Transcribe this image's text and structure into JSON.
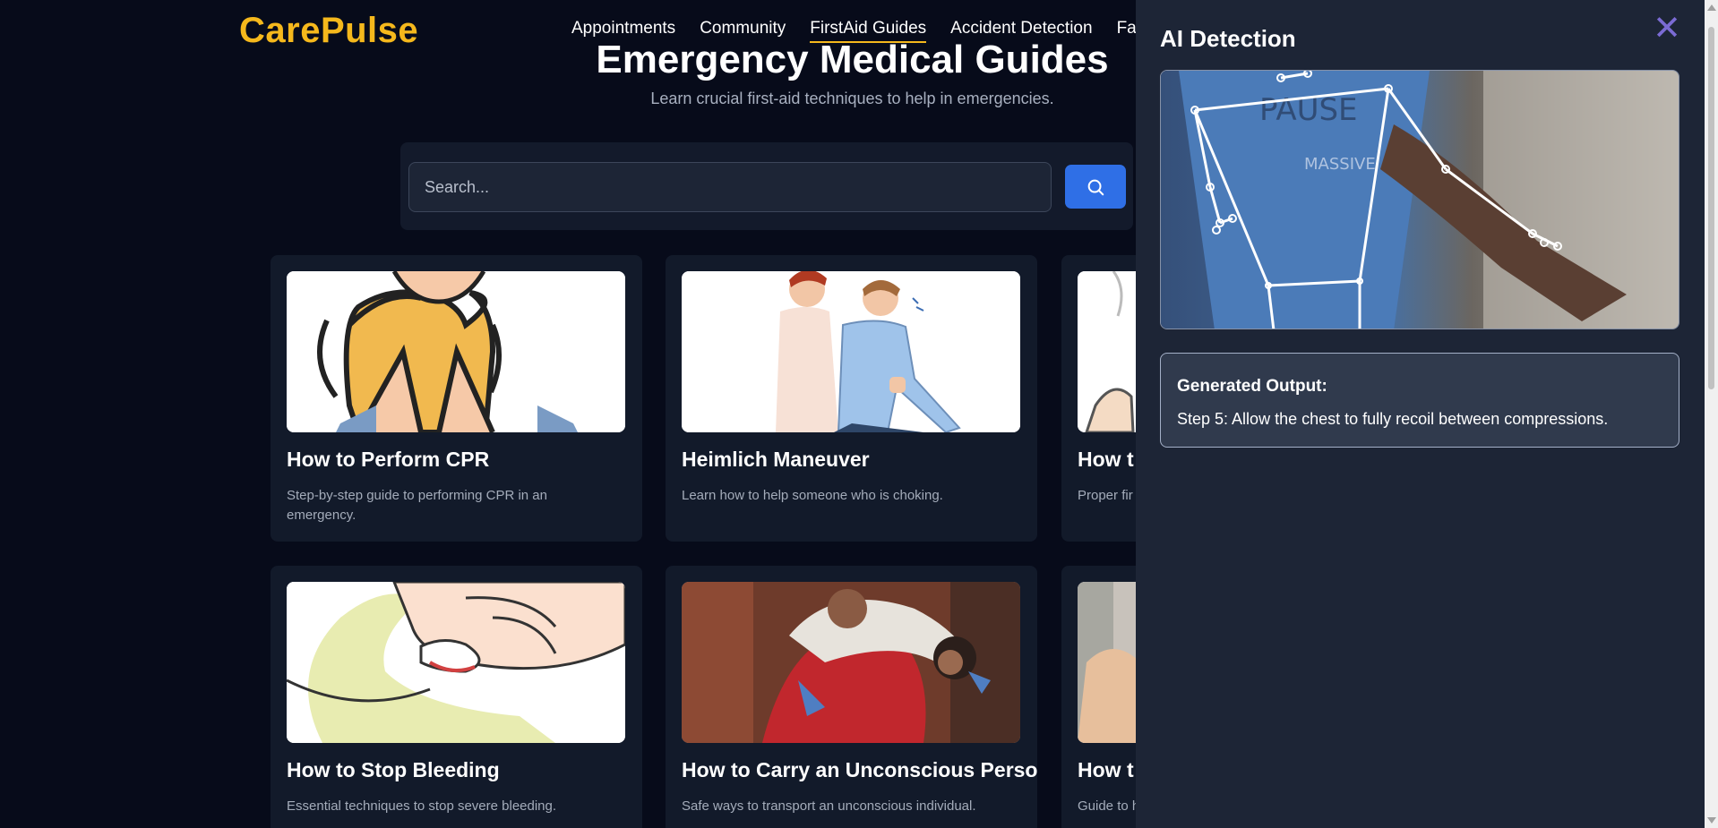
{
  "header": {
    "logo": "CarePulse",
    "nav": [
      "Appointments",
      "Community",
      "FirstAid Guides",
      "Accident Detection",
      "Face F"
    ],
    "active_nav": "FirstAid Guides",
    "accent_color": "#f5b81c"
  },
  "hero": {
    "title": "Emergency Medical Guides",
    "subtitle": "Learn crucial first-aid techniques to help in emergencies."
  },
  "search": {
    "placeholder": "Search...",
    "button_icon": "search-icon",
    "button_color": "#2f6fe6"
  },
  "cards": [
    {
      "title": "How to Perform CPR",
      "description": "Step-by-step guide to performing CPR in an emergency.",
      "image": "cpr-illustration"
    },
    {
      "title": "Heimlich Maneuver",
      "description": "Learn how to help someone who is choking.",
      "image": "heimlich-illustration"
    },
    {
      "title": "How t",
      "description": "Proper fir",
      "image": "partial-illustration"
    },
    {
      "title": "How to Stop Bleeding",
      "description": "Essential techniques to stop severe bleeding.",
      "image": "bleeding-illustration"
    },
    {
      "title": "How to Carry an Unconscious Person",
      "description": "Safe ways to transport an unconscious individual.",
      "image": "carry-person-photo"
    },
    {
      "title": "How t",
      "description": "Guide to help",
      "image": "partial-photo"
    }
  ],
  "side_panel": {
    "title": "AI Detection",
    "close_icon": "close-icon",
    "close_color": "#7b6bd4",
    "detection_image": "pose-detection-camera-feed",
    "output_heading": "Generated Output:",
    "output_text": "Step 5: Allow the chest to fully recoil between compressions."
  }
}
